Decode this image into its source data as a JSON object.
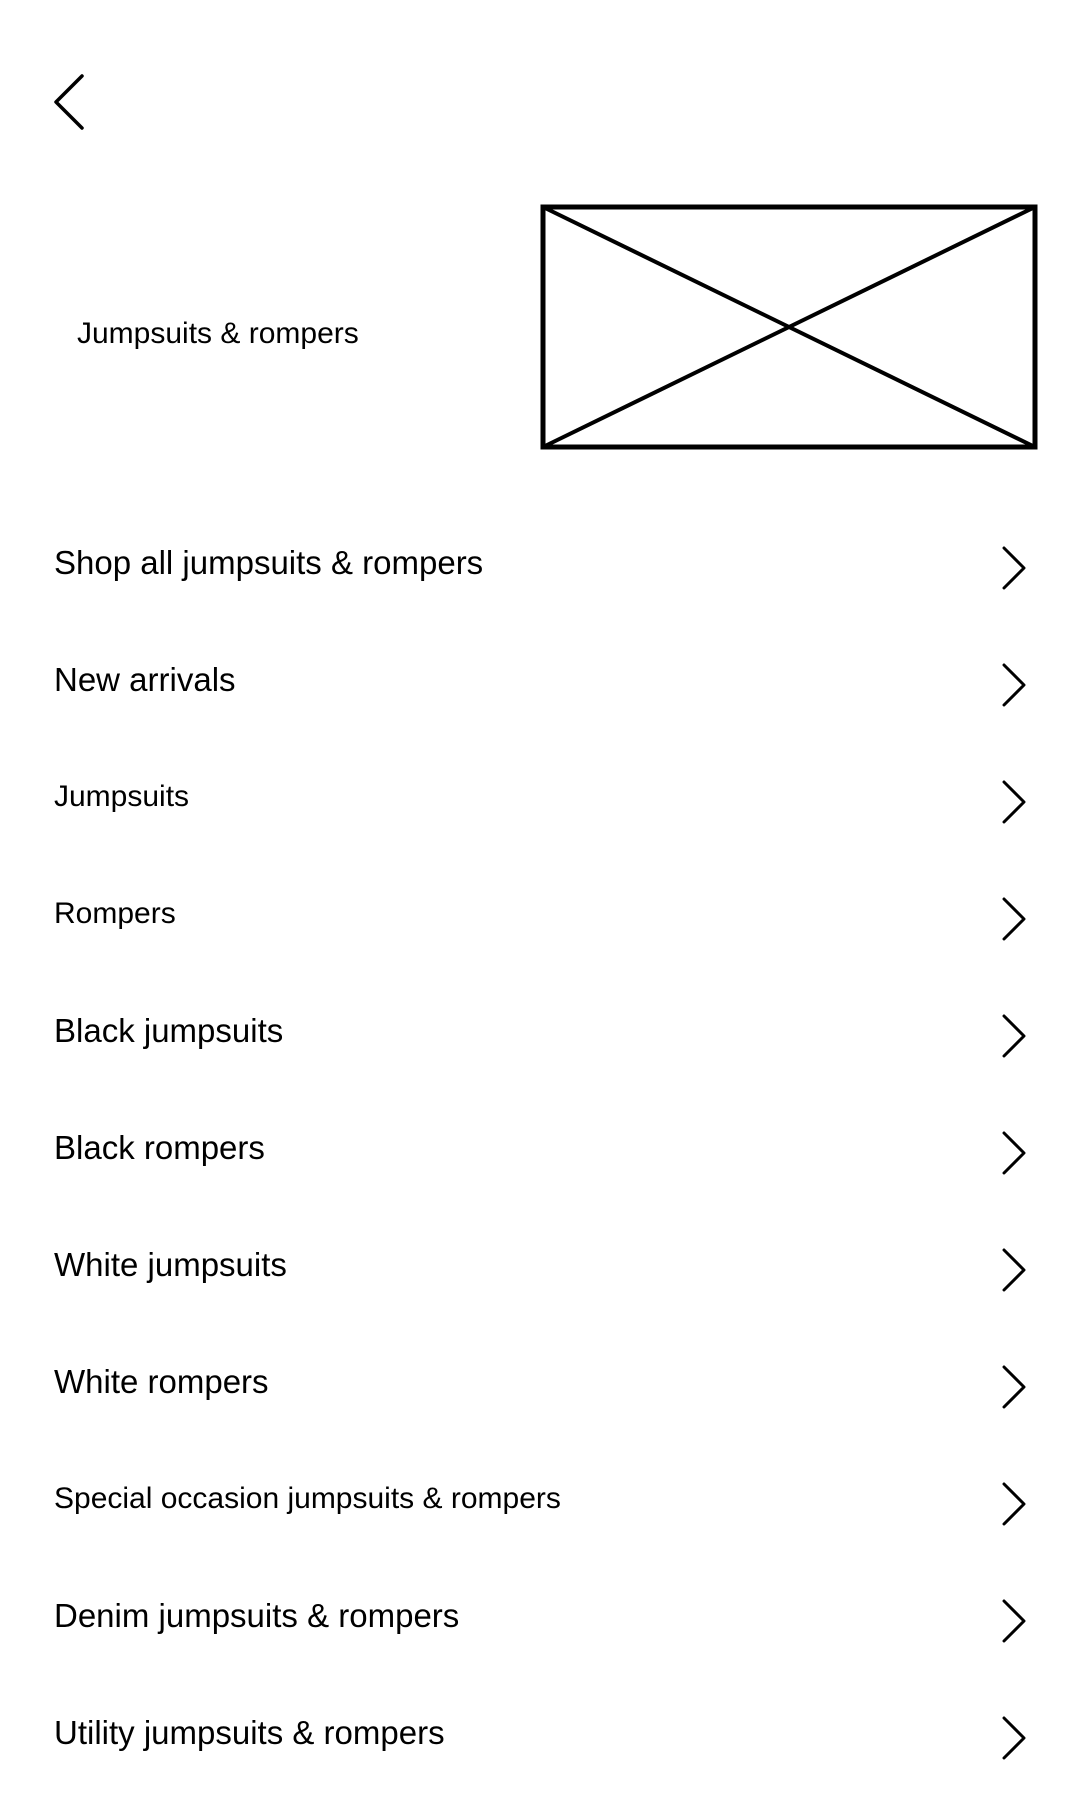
{
  "header": {
    "back_icon": "chevron-left-icon"
  },
  "hero": {
    "title": "Jumpsuits & rompers",
    "image_placeholder": "image-placeholder"
  },
  "menu": {
    "items": [
      {
        "label": "Shop all jumpsuits & rompers"
      },
      {
        "label": "New arrivals"
      },
      {
        "label": "Jumpsuits"
      },
      {
        "label": "Rompers"
      },
      {
        "label": "Black jumpsuits"
      },
      {
        "label": "Black rompers"
      },
      {
        "label": "White jumpsuits"
      },
      {
        "label": "White rompers"
      },
      {
        "label": "Special occasion jumpsuits & rompers"
      },
      {
        "label": "Denim jumpsuits & rompers"
      },
      {
        "label": "Utility jumpsuits & rompers"
      }
    ],
    "item_icon": "chevron-right-icon"
  }
}
